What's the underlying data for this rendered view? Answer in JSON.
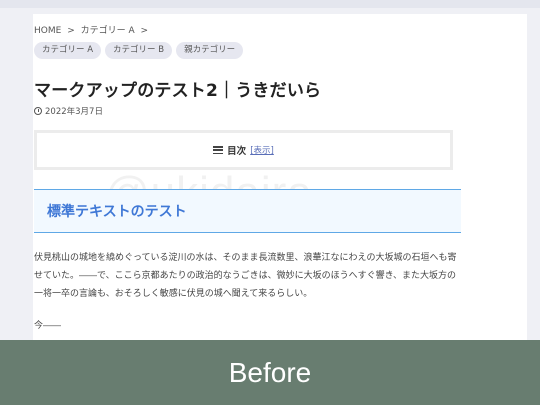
{
  "breadcrumb": {
    "items": [
      "HOME",
      ">",
      "カテゴリー A",
      ">"
    ]
  },
  "categories": [
    "カテゴリー A",
    "カテゴリー B",
    "親カテゴリー"
  ],
  "article": {
    "title": "マークアップのテスト2｜うきだいら",
    "date": "2022年3月7日"
  },
  "toc": {
    "title": "目次",
    "toggle": "[表示]"
  },
  "watermark": "@ukidaira",
  "section": {
    "heading": "標準テキストのテスト"
  },
  "paragraph": "伏見桃山の城地を繞めぐっている淀川の水は、そのまま長流数里、浪華江なにわえの大坂城の石垣へも寄せていた。――で、ここら京都あたりの政治的なうごきは、微妙に大坂のほうへすぐ響き、また大坂方の一将一卒の言論も、おそろしく敏感に伏見の城へ聞えて来るらしい。",
  "next_text": "今――",
  "banner": {
    "label": "Before",
    "color": "#687d70"
  }
}
